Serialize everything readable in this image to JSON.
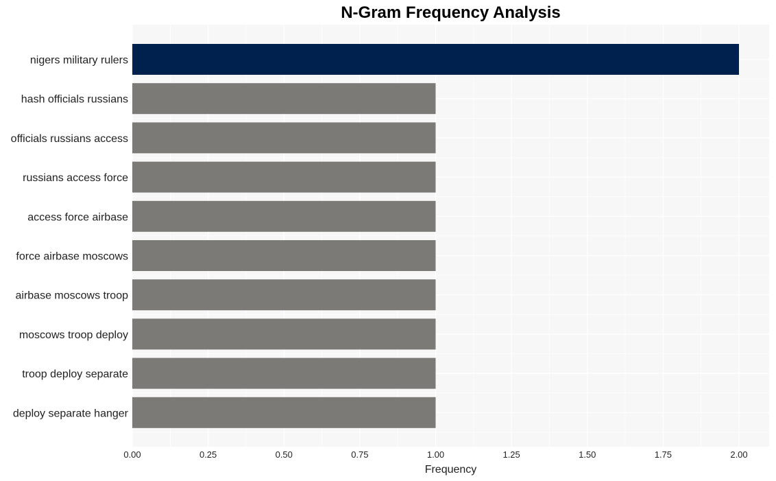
{
  "chart_data": {
    "type": "bar",
    "orientation": "horizontal",
    "title": "N-Gram Frequency Analysis",
    "xlabel": "Frequency",
    "ylabel": "",
    "xlim": [
      0,
      2.1
    ],
    "xticks": [
      0.0,
      0.25,
      0.5,
      0.75,
      1.0,
      1.25,
      1.5,
      1.75,
      2.0
    ],
    "xtick_labels": [
      "0.00",
      "0.25",
      "0.50",
      "0.75",
      "1.00",
      "1.25",
      "1.50",
      "1.75",
      "2.00"
    ],
    "grid": true,
    "categories": [
      "nigers military rulers",
      "hash officials russians",
      "officials russians access",
      "russians access force",
      "access force airbase",
      "force airbase moscows",
      "airbase moscows troop",
      "moscows troop deploy",
      "troop deploy separate",
      "deploy separate hanger"
    ],
    "values": [
      2,
      1,
      1,
      1,
      1,
      1,
      1,
      1,
      1,
      1
    ],
    "colors": {
      "highlight": "#00214d",
      "default": "#7b7a76",
      "plot_background": "#f7f7f7",
      "grid": "#ffffff"
    }
  }
}
